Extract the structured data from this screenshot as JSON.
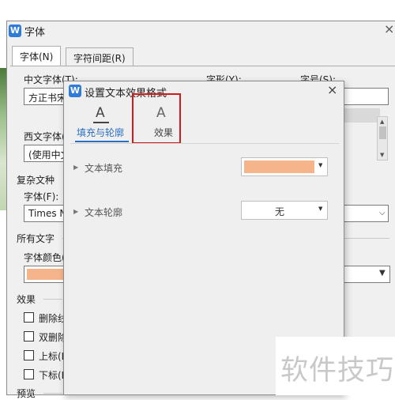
{
  "font_dialog": {
    "title": "字体",
    "close_glyph": "×",
    "tabs": [
      {
        "label": "字体(N)"
      },
      {
        "label": "字符间距(R)"
      }
    ],
    "chinese_font_label": "中文字体(T):",
    "chinese_font_value": "方正书宋",
    "style_label": "字形(Y):",
    "size_label": "字号(S):",
    "western_font_label": "西文字体(",
    "western_font_value": "(使用中文",
    "complex_section": "复杂文种",
    "complex_font_label": "字体(F):",
    "complex_font_value": "Times N",
    "all_text_section": "所有文字",
    "font_color_label": "字体颜色(",
    "font_color_value": "#f5b48a",
    "effects_section": "效果",
    "checkboxes": [
      {
        "label": "删除线",
        "checked": false
      },
      {
        "label": "双删除",
        "checked": false
      },
      {
        "label": "上标(P",
        "checked": false
      },
      {
        "label": "下标(B",
        "checked": false
      }
    ],
    "preview_section": "预览"
  },
  "effect_dialog": {
    "title": "设置文本效果格式",
    "close_glyph": "×",
    "tabs": [
      {
        "icon": "text-outline-A-icon",
        "glyph": "A",
        "label": "填充与轮廓",
        "selected": true
      },
      {
        "icon": "text-effect-A-icon",
        "glyph": "A",
        "label": "效果",
        "selected": false,
        "highlighted": true
      }
    ],
    "rows": [
      {
        "label": "文本填充",
        "control": "color",
        "color": "#f5b48a"
      },
      {
        "label": "文本轮廓",
        "control": "dropdown",
        "value": "无"
      }
    ]
  },
  "watermark": "软件技巧",
  "colors": {
    "accent_blue": "#2a6fc0",
    "highlight_red": "#d11a1a",
    "fill_orange": "#f5b48a"
  }
}
